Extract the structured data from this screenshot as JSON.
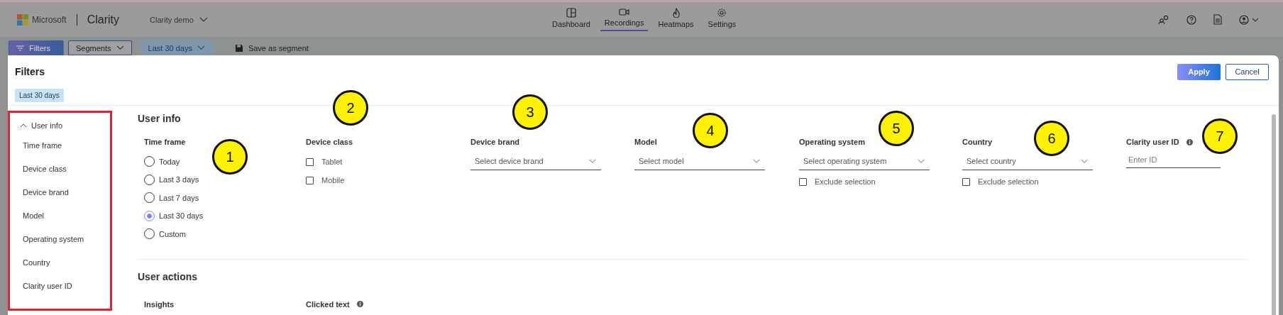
{
  "header": {
    "brand": "Microsoft",
    "product": "Clarity",
    "project": "Clarity demo",
    "nav": [
      {
        "label": "Dashboard",
        "selected": false
      },
      {
        "label": "Recordings",
        "selected": true
      },
      {
        "label": "Heatmaps",
        "selected": false
      },
      {
        "label": "Settings",
        "selected": false
      }
    ]
  },
  "toolbar": [
    {
      "label": "Filters",
      "kind": "primary"
    },
    {
      "label": "Segments",
      "kind": "dropdown"
    },
    {
      "label": "Last 30 days",
      "kind": "select"
    },
    {
      "label": "Save as segment",
      "kind": "action"
    }
  ],
  "dialog": {
    "title": "Filters",
    "buttons": [
      {
        "label": "Apply",
        "kind": "primary"
      },
      {
        "label": "Cancel",
        "kind": "secondary"
      }
    ],
    "chips": [
      "Last 30 days"
    ],
    "sidebar": {
      "group": "User info",
      "expanded": true,
      "items": [
        "Time frame",
        "Device class",
        "Device brand",
        "Model",
        "Operating system",
        "Country",
        "Clarity user ID"
      ]
    },
    "sections": [
      {
        "title": "User info",
        "fields": [
          {
            "kind": "radio",
            "label": "Time frame",
            "annotation": "1",
            "options": [
              {
                "label": "Today",
                "selected": false
              },
              {
                "label": "Last 3 days",
                "selected": false
              },
              {
                "label": "Last 7 days",
                "selected": false
              },
              {
                "label": "Last 30 days",
                "selected": true
              },
              {
                "label": "Custom",
                "selected": false
              }
            ]
          },
          {
            "kind": "checkbox",
            "label": "Device class",
            "annotation": "2",
            "options": [
              {
                "label": "Tablet",
                "checked": false
              },
              {
                "label": "Mobile",
                "checked": false
              }
            ]
          },
          {
            "kind": "select",
            "label": "Device brand",
            "annotation": "3",
            "placeholder": "Select device brand"
          },
          {
            "kind": "select",
            "label": "Model",
            "annotation": "4",
            "placeholder": "Select model"
          },
          {
            "kind": "select",
            "label": "Operating system",
            "annotation": "5",
            "placeholder": "Select operating system",
            "exclude": {
              "label": "Exclude selection",
              "checked": false
            }
          },
          {
            "kind": "select",
            "label": "Country",
            "annotation": "6",
            "placeholder": "Select country",
            "exclude": {
              "label": "Exclude selection",
              "checked": false
            }
          },
          {
            "kind": "text",
            "label": "Clarity user ID",
            "annotation": "7",
            "info": true,
            "placeholder": "Enter ID"
          }
        ]
      },
      {
        "title": "User actions",
        "fields": [
          {
            "kind": "heading",
            "label": "Insights"
          },
          {
            "kind": "heading",
            "label": "Clicked text",
            "info": true
          }
        ]
      }
    ]
  }
}
